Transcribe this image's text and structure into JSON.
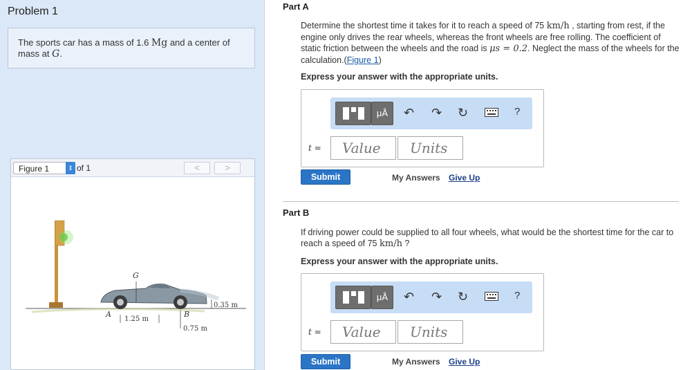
{
  "problem": {
    "title": "Problem 1"
  },
  "intro": {
    "text_1": "The sports car has a mass of 1.6 ",
    "mass_unit": "Mg",
    "text_2": " and a center of mass at ",
    "cg": "G",
    "text_3": "."
  },
  "figure": {
    "select_label": "Figure 1",
    "of_label": "of 1",
    "prev": "<",
    "next": ">",
    "labels": {
      "G": "G",
      "A": "A",
      "B": "B",
      "dim_ag": "1.25 m",
      "dim_gb": "0.75 m",
      "height": "0.35 m"
    }
  },
  "part_a": {
    "header": "Part A",
    "q_1": "Determine the shortest time it takes for it to reach a speed of 75 ",
    "q_unit": "km/h",
    "q_2": " , starting from rest, if the engine only drives the rear wheels, whereas the front wheels are free rolling. The coefficient of static friction between the wheels and the road is ",
    "q_mu": "μs = 0.2",
    "q_3": ". Neglect the mass of the wheels for the calculation.(",
    "q_link": "Figure 1",
    "q_4": ")",
    "instruction": "Express your answer with the appropriate units.",
    "var_label": "t =",
    "value_placeholder": "Value",
    "units_placeholder": "Units",
    "submit": "Submit",
    "my_answers": "My Answers",
    "give_up": "Give Up"
  },
  "part_b": {
    "header": "Part B",
    "q_1": "If driving power could be supplied to all four wheels, what would be the shortest time for the car to reach a speed of 75 ",
    "q_unit": "km/h",
    "q_2": " ?",
    "instruction": "Express your answer with the appropriate units.",
    "var_label": "t =",
    "value_placeholder": "Value",
    "units_placeholder": "Units",
    "submit": "Submit",
    "my_answers": "My Answers",
    "give_up": "Give Up"
  },
  "toolbar": {
    "mu_label": "μÅ",
    "help": "?"
  }
}
